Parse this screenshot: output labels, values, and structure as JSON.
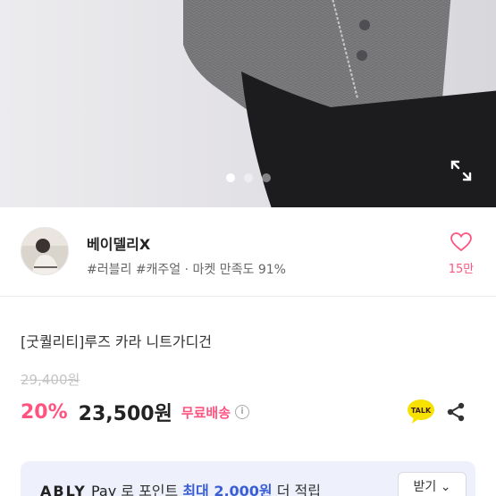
{
  "gallery": {
    "page_count": 3,
    "active_index": 0
  },
  "seller": {
    "name": "베이델리X",
    "tags": "#러블리 #캐주얼 · 마켓 만족도 91%",
    "like_count": "15만"
  },
  "product": {
    "title": "[굿퀄리티]루즈 카라 니트가디건",
    "original_price": "29,400원",
    "discount": "20%",
    "price": "23,500원",
    "shipping": "무료배송"
  },
  "actions": {
    "talk_label": "TALK"
  },
  "banner": {
    "brand": "ABLY",
    "pay": "Pay",
    "text_before": " 로 포인트 ",
    "highlight": "최대 2,000원",
    "text_after": " 더 적립",
    "button_label": "받기 ⌄"
  },
  "colors": {
    "accent_pink": "#ff5480",
    "highlight_blue": "#3a5ed8",
    "banner_bg": "#eef1fb"
  }
}
